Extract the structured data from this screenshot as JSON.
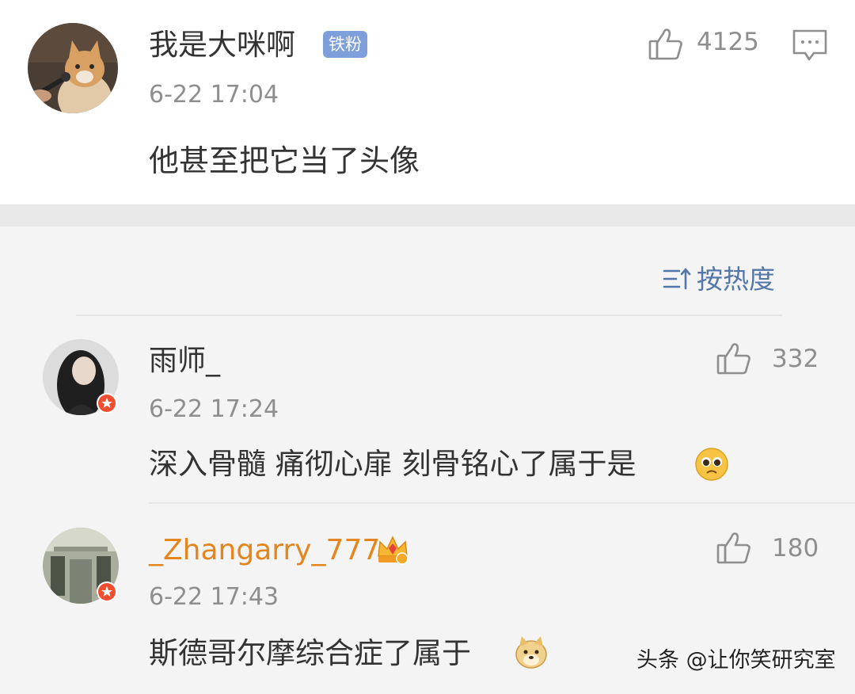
{
  "main_comment": {
    "username": "我是大咪啊",
    "badge": "铁粉",
    "timestamp": "6-22 17:04",
    "content": "他甚至把它当了头像",
    "likes": "4125",
    "avatar_icon": "cat-with-microphone-avatar"
  },
  "sort": {
    "label": "按热度",
    "icon": "sort-icon"
  },
  "replies": [
    {
      "username": "雨师_",
      "timestamp": "6-22 17:24",
      "content": "深入骨髓 痛彻心扉 刻骨铭心了属于是",
      "likes": "332",
      "emoji": "pleading-face-emoji"
    },
    {
      "username": "_Zhangarry_777",
      "timestamp": "6-22 17:43",
      "content": "斯德哥尔摩综合症了属于",
      "likes": "180",
      "emoji": "doge-emoji"
    }
  ],
  "watermark": "头条 @让你笑研究室",
  "colors": {
    "username_gold": "#e5851d",
    "sort_blue": "#5377a8",
    "badge_blue": "#7e9fd9",
    "timestamp_gray": "#8e8e8e"
  }
}
